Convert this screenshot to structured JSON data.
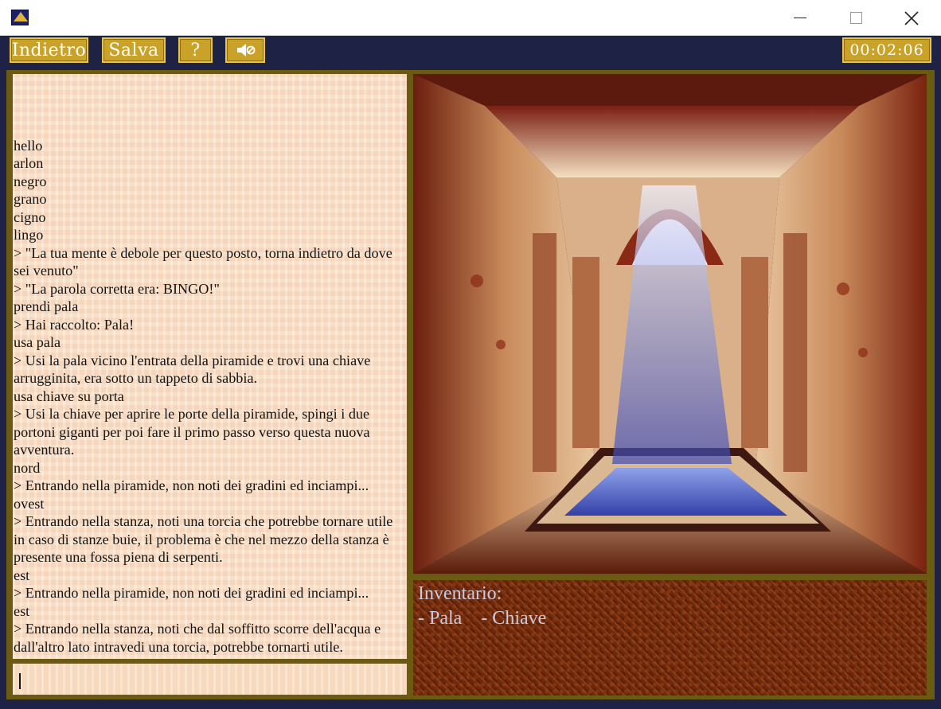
{
  "window": {
    "icon": "pyramid-app-icon",
    "controls": {
      "minimize": "minimize-icon",
      "maximize": "maximize-icon",
      "close": "close-icon"
    }
  },
  "toolbar": {
    "back_label": "Indietro",
    "save_label": "Salva",
    "help_label": "?",
    "sound_icon": "speaker-muted-icon",
    "timer": "00:02:06"
  },
  "log": {
    "lines": [
      "hello",
      "arlon",
      "negro",
      "grano",
      "cigno",
      "lingo",
      "> \"La tua mente è debole per questo posto, torna indietro da dove sei venuto\"",
      "> \"La parola corretta era: BINGO!\"",
      "prendi pala",
      "> Hai raccolto: Pala!",
      "usa pala",
      "> Usi la pala vicino l'entrata della piramide e trovi una chiave arrugginita, era sotto un tappeto di sabbia.",
      "usa chiave su porta",
      "> Usi la chiave per aprire le porte della piramide, spingi i due portoni giganti per poi fare il primo passo verso questa nuova avventura.",
      "nord",
      "> Entrando nella piramide, non noti dei gradini ed inciampi...",
      "ovest",
      "> Entrando nella stanza, noti una torcia che potrebbe tornare utile in caso di stanze buie, il problema è che nel mezzo della stanza è presente una fossa piena di serpenti.",
      "est",
      "> Entrando nella piramide, non noti dei gradini ed inciampi...",
      "est",
      "> Entrando nella stanza, noti che dal soffitto scorre dell'acqua e dall'altro lato intravedi una torcia, potrebbe tornarti utile."
    ]
  },
  "command": {
    "value": ""
  },
  "inventory": {
    "title": "Inventario:",
    "items": [
      "- Pala",
      "- Chiave"
    ]
  },
  "colors": {
    "button": "#c9a227",
    "frame": "#6a5a12",
    "inventory_text": "#c8cbe0",
    "log_bg": "#f8dcc2"
  }
}
